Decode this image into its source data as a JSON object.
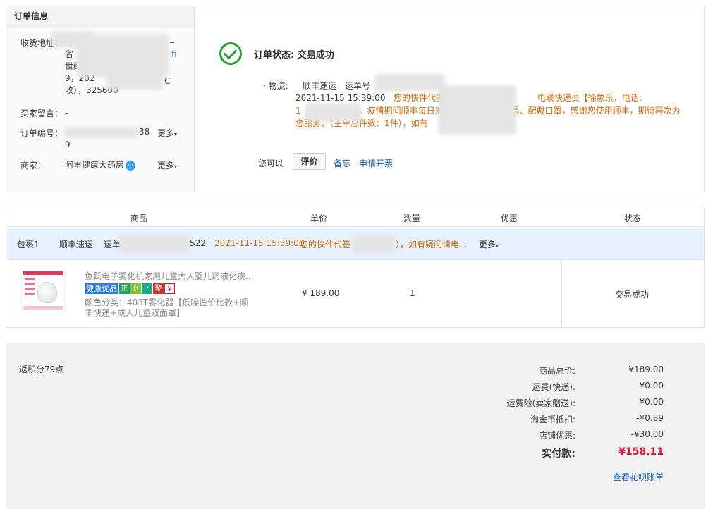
{
  "order_info": {
    "heading": "订单信息",
    "address_label": "收货地址：",
    "address_lines": [
      "省",
      "世纪",
      "9，202",
      "收），325600"
    ],
    "address_tail_fragments": [
      "_",
      "fi",
      "C"
    ],
    "message_label": "买家留言：",
    "message_value": "-",
    "order_no_label": "订单编号：",
    "order_no_visible_head": "38",
    "order_no_visible_tail": "9",
    "order_more": "更多",
    "seller_label": "商家：",
    "seller_name": "阿里健康大药房",
    "seller_more": "更多"
  },
  "status": {
    "title": "订单状态: 交易成功",
    "logistics_label": "· 物流:",
    "carrier": "顺丰速运",
    "tracking_label": "运单号",
    "log_time": "2021-11-15 15:39:00",
    "log_text_1": "您的快件代签收",
    "log_text_1b": "电联快递员【徐象乐，电话:",
    "log_text_2": "。疫情期间顺丰每日对网点",
    "log_text_2b": "员每日测温、配戴口罩，感谢您使用顺丰，期待再次为",
    "log_text_3": "您服务。（主单总件数：1件），如有",
    "log_text_prefix_digit": "1",
    "you_can": "您可以",
    "review_btn": "评价",
    "memo_link": "备忘",
    "invoice_link": "申请开票"
  },
  "goods": {
    "headers": [
      "商品",
      "单价",
      "数量",
      "优惠",
      "状态"
    ],
    "package": {
      "label": "包裹1",
      "carrier": "顺丰速运",
      "tracking_prefix": "运单",
      "tracking_suffix": "522",
      "time": "2021-11-15 15:39:00",
      "text_a": "您的快件代签",
      "text_b": "），如有疑问请电...",
      "more": "更多"
    },
    "item": {
      "title": "鱼跃电子雾化机家用儿童大人婴儿药液化痰...",
      "tag_health": "健康优品",
      "tag_icons": [
        {
          "text": "正",
          "color": "#22a35a"
        },
        {
          "text": "₿",
          "color": "#7bc62d"
        },
        {
          "text": "7",
          "color": "#18a88a"
        },
        {
          "text": "聚",
          "color": "#c0392b"
        },
        {
          "text": "¥",
          "color": "#e8102f"
        }
      ],
      "sku": "颜色分类：403T雾化器【低噪性价比款+顺丰快递+成人儿童双面罩】",
      "price": "¥ 189.00",
      "quantity": "1",
      "status": "交易成功"
    }
  },
  "totals": {
    "points": "返积分79点",
    "rows": [
      {
        "label": "商品总价:",
        "value": "¥189.00"
      },
      {
        "label": "运费(快递):",
        "value": "¥0.00"
      },
      {
        "label": "运费险(卖家赠送):",
        "value": "¥0.00"
      },
      {
        "label": "淘金币抵扣:",
        "value": "-¥0.89"
      },
      {
        "label": "店铺优惠:",
        "value": "-¥30.00"
      }
    ],
    "paid_label": "实付款:",
    "paid_value": "¥158.11",
    "bill_link": "查看花呗账单"
  }
}
